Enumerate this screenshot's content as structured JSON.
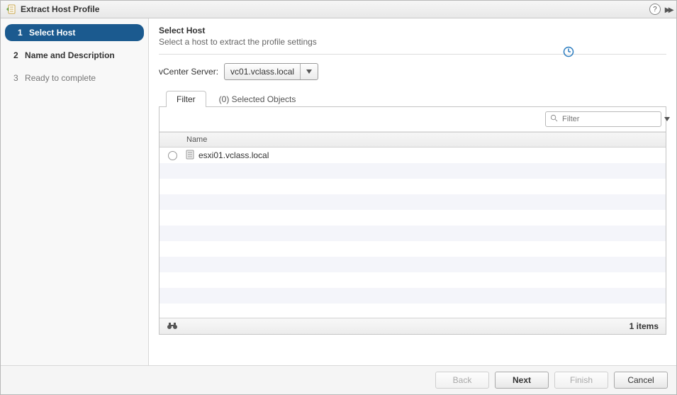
{
  "titlebar": {
    "title": "Extract Host Profile"
  },
  "sidebar": {
    "steps": [
      {
        "num": "1",
        "label": "Select Host"
      },
      {
        "num": "2",
        "label": "Name and Description"
      },
      {
        "num": "3",
        "label": "Ready to complete"
      }
    ]
  },
  "main": {
    "title": "Select Host",
    "subtitle": "Select a host to extract the profile settings",
    "server_label": "vCenter Server:",
    "server_value": "vc01.vclass.local"
  },
  "tabs": {
    "filter": "Filter",
    "selected": "(0) Selected Objects"
  },
  "table": {
    "filter_placeholder": "Filter",
    "col_name": "Name",
    "rows": [
      {
        "name": "esxi01.vclass.local"
      }
    ],
    "count_label": "1 items"
  },
  "footer": {
    "back": "Back",
    "next": "Next",
    "finish": "Finish",
    "cancel": "Cancel"
  }
}
